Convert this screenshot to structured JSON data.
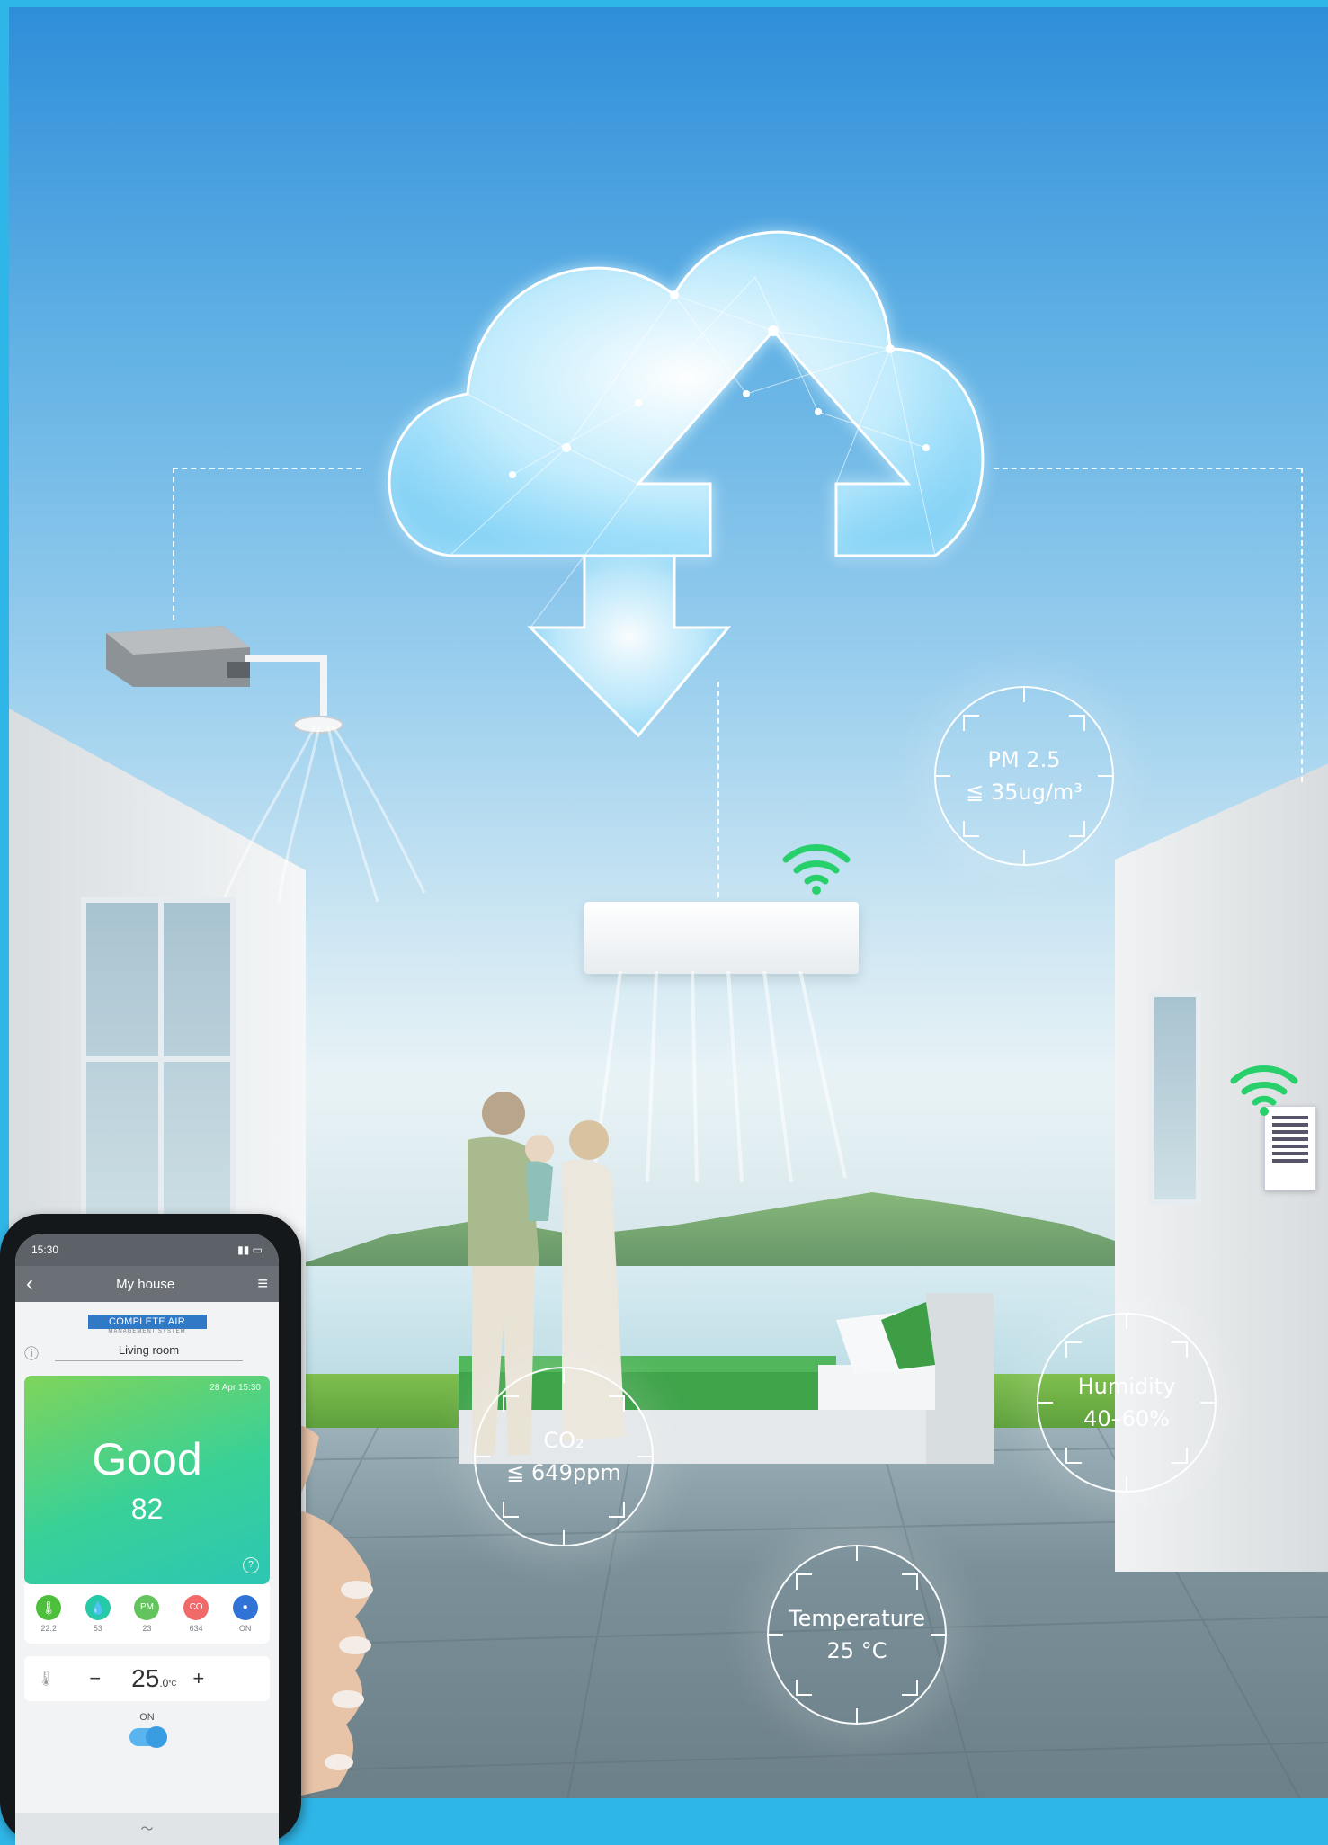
{
  "sensors": {
    "pm25": {
      "label": "PM 2.5",
      "value": "≦ 35ug/m³"
    },
    "co2": {
      "label": "CO₂",
      "value": "≦ 649ppm"
    },
    "humidity": {
      "label": "Humidity",
      "value": "40–60%"
    },
    "temperature": {
      "label": "Temperature",
      "value": "25 °C"
    }
  },
  "phone": {
    "status_time": "15:30",
    "app_title": "My house",
    "back_glyph": "‹",
    "menu_glyph": "≡",
    "logo_text": "COMPLETE AIR",
    "logo_subtext": "MANAGEMENT SYSTEM",
    "info_glyph": "ⓘ",
    "room_label": "Living room",
    "card": {
      "date": "28 Apr 15:30",
      "status": "Good",
      "score": "82",
      "help_glyph": "?"
    },
    "metrics": [
      {
        "icon": "thermometer-icon",
        "glyph": "🌡",
        "value": "22.2",
        "color": "#4dbf3c"
      },
      {
        "icon": "droplet-icon",
        "glyph": "💧",
        "value": "53",
        "color": "#26c9a8"
      },
      {
        "icon": "pm-icon",
        "glyph": "PM",
        "value": "23",
        "color": "#63c45d"
      },
      {
        "icon": "co2-icon",
        "glyph": "CO",
        "value": "634",
        "color": "#f16a6a"
      },
      {
        "icon": "fan-icon",
        "glyph": "●",
        "value": "ON",
        "color": "#2f73d6"
      }
    ],
    "thermostat": {
      "minus": "−",
      "value": "25",
      "decimal": ".0",
      "unit": "°C",
      "plus": "+"
    },
    "power_label": "ON",
    "bottom_glyph": "〜"
  },
  "colors": {
    "sky_top": "#2f8ed9",
    "wifi": "#27d06b",
    "card_start": "#7fd45a",
    "card_end": "#2cc6b4"
  }
}
